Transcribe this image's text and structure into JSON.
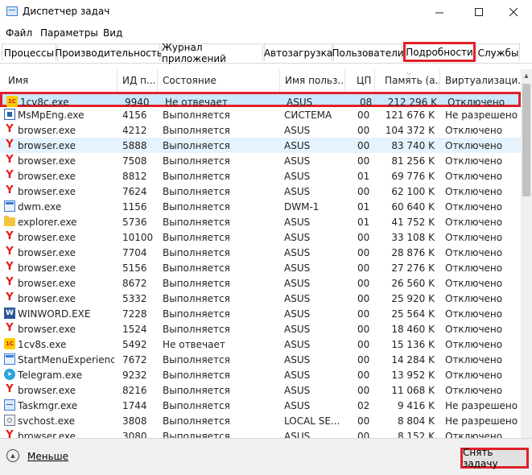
{
  "window": {
    "title": "Диспетчер задач",
    "minimize_icon": "minimize-icon",
    "maximize_icon": "maximize-icon",
    "close_icon": "close-icon"
  },
  "menu": [
    "Файл",
    "Параметры",
    "Вид"
  ],
  "tabs": [
    {
      "label": "Процессы",
      "active": false
    },
    {
      "label": "Производительность",
      "active": false
    },
    {
      "label": "Журнал приложений",
      "active": false
    },
    {
      "label": "Автозагрузка",
      "active": false
    },
    {
      "label": "Пользователи",
      "active": false
    },
    {
      "label": "Подробности",
      "active": true
    },
    {
      "label": "Службы",
      "active": false
    }
  ],
  "columns": {
    "name": "Имя",
    "pid": "ИД п...",
    "state": "Состояние",
    "user": "Имя польз...",
    "cpu": "ЦП",
    "memory": "Память (а...",
    "virtualization": "Виртуализаци..."
  },
  "rows": [
    {
      "icon": "1c-icon",
      "name": "1cv8c.exe",
      "pid": "9940",
      "state": "Не отвечает",
      "user": "ASUS",
      "cpu": "08",
      "memory": "212 296 K",
      "virt": "Отключено",
      "highlighted": true
    },
    {
      "icon": "defender-icon",
      "name": "MsMpEng.exe",
      "pid": "4156",
      "state": "Выполняется",
      "user": "СИСТЕМА",
      "cpu": "00",
      "memory": "121 676 K",
      "virt": "Не разрешено"
    },
    {
      "icon": "yandex-browser-icon",
      "name": "browser.exe",
      "pid": "4212",
      "state": "Выполняется",
      "user": "ASUS",
      "cpu": "00",
      "memory": "104 372 K",
      "virt": "Отключено"
    },
    {
      "icon": "yandex-browser-icon",
      "name": "browser.exe",
      "pid": "5888",
      "state": "Выполняется",
      "user": "ASUS",
      "cpu": "00",
      "memory": "83 740 K",
      "virt": "Отключено",
      "hover": true
    },
    {
      "icon": "yandex-browser-icon",
      "name": "browser.exe",
      "pid": "7508",
      "state": "Выполняется",
      "user": "ASUS",
      "cpu": "00",
      "memory": "81 256 K",
      "virt": "Отключено"
    },
    {
      "icon": "yandex-browser-icon",
      "name": "browser.exe",
      "pid": "8812",
      "state": "Выполняется",
      "user": "ASUS",
      "cpu": "01",
      "memory": "69 776 K",
      "virt": "Отключено"
    },
    {
      "icon": "yandex-browser-icon",
      "name": "browser.exe",
      "pid": "7624",
      "state": "Выполняется",
      "user": "ASUS",
      "cpu": "00",
      "memory": "62 100 K",
      "virt": "Отключено"
    },
    {
      "icon": "window-icon",
      "name": "dwm.exe",
      "pid": "1156",
      "state": "Выполняется",
      "user": "DWM-1",
      "cpu": "01",
      "memory": "60 640 K",
      "virt": "Отключено"
    },
    {
      "icon": "folder-icon",
      "name": "explorer.exe",
      "pid": "5736",
      "state": "Выполняется",
      "user": "ASUS",
      "cpu": "01",
      "memory": "41 752 K",
      "virt": "Отключено"
    },
    {
      "icon": "yandex-browser-icon",
      "name": "browser.exe",
      "pid": "10100",
      "state": "Выполняется",
      "user": "ASUS",
      "cpu": "00",
      "memory": "33 108 K",
      "virt": "Отключено"
    },
    {
      "icon": "yandex-browser-icon",
      "name": "browser.exe",
      "pid": "7704",
      "state": "Выполняется",
      "user": "ASUS",
      "cpu": "00",
      "memory": "28 876 K",
      "virt": "Отключено"
    },
    {
      "icon": "yandex-browser-icon",
      "name": "browser.exe",
      "pid": "5156",
      "state": "Выполняется",
      "user": "ASUS",
      "cpu": "00",
      "memory": "27 276 K",
      "virt": "Отключено"
    },
    {
      "icon": "yandex-browser-icon",
      "name": "browser.exe",
      "pid": "8672",
      "state": "Выполняется",
      "user": "ASUS",
      "cpu": "00",
      "memory": "26 560 K",
      "virt": "Отключено"
    },
    {
      "icon": "yandex-browser-icon",
      "name": "browser.exe",
      "pid": "5332",
      "state": "Выполняется",
      "user": "ASUS",
      "cpu": "00",
      "memory": "25 920 K",
      "virt": "Отключено"
    },
    {
      "icon": "word-icon",
      "name": "WINWORD.EXE",
      "pid": "7228",
      "state": "Выполняется",
      "user": "ASUS",
      "cpu": "00",
      "memory": "25 564 K",
      "virt": "Отключено"
    },
    {
      "icon": "yandex-browser-icon",
      "name": "browser.exe",
      "pid": "1524",
      "state": "Выполняется",
      "user": "ASUS",
      "cpu": "00",
      "memory": "18 460 K",
      "virt": "Отключено"
    },
    {
      "icon": "1c-icon",
      "name": "1cv8s.exe",
      "pid": "5492",
      "state": "Не отвечает",
      "user": "ASUS",
      "cpu": "00",
      "memory": "15 136 K",
      "virt": "Отключено"
    },
    {
      "icon": "window-icon",
      "name": "StartMenuExperienc...",
      "pid": "7672",
      "state": "Выполняется",
      "user": "ASUS",
      "cpu": "00",
      "memory": "14 284 K",
      "virt": "Отключено"
    },
    {
      "icon": "telegram-icon",
      "name": "Telegram.exe",
      "pid": "9232",
      "state": "Выполняется",
      "user": "ASUS",
      "cpu": "00",
      "memory": "13 952 K",
      "virt": "Отключено"
    },
    {
      "icon": "yandex-browser-icon",
      "name": "browser.exe",
      "pid": "8216",
      "state": "Выполняется",
      "user": "ASUS",
      "cpu": "00",
      "memory": "11 068 K",
      "virt": "Отключено"
    },
    {
      "icon": "taskmgr-icon",
      "name": "Taskmgr.exe",
      "pid": "1744",
      "state": "Выполняется",
      "user": "ASUS",
      "cpu": "02",
      "memory": "9 416 K",
      "virt": "Не разрешено"
    },
    {
      "icon": "service-icon",
      "name": "svchost.exe",
      "pid": "3808",
      "state": "Выполняется",
      "user": "LOCAL SE...",
      "cpu": "00",
      "memory": "8 804 K",
      "virt": "Не разрешено"
    },
    {
      "icon": "yandex-browser-icon",
      "name": "browser.exe",
      "pid": "3080",
      "state": "Выполняется",
      "user": "ASUS",
      "cpu": "00",
      "memory": "8 152 K",
      "virt": "Отключено"
    }
  ],
  "footer": {
    "less_label": "Меньше",
    "end_task_label": "Снять задачу"
  }
}
